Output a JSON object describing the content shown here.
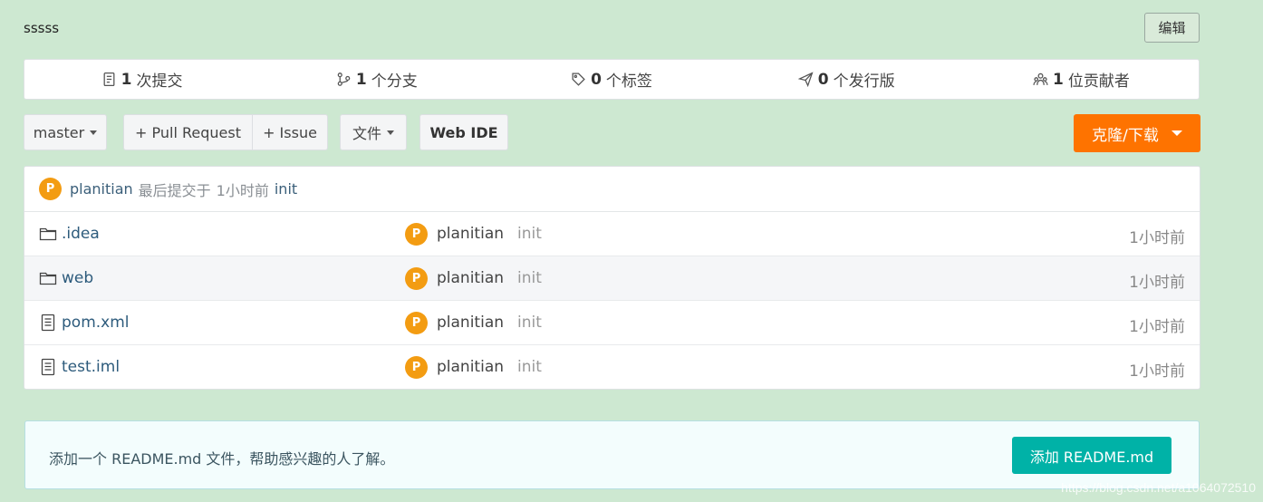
{
  "repo": {
    "description": "sssss",
    "edit_label": "编辑"
  },
  "stats": [
    {
      "icon": "commit-icon",
      "count": "1",
      "label": "次提交"
    },
    {
      "icon": "branch-icon",
      "count": "1",
      "label": "个分支"
    },
    {
      "icon": "tag-icon",
      "count": "0",
      "label": "个标签"
    },
    {
      "icon": "release-icon",
      "count": "0",
      "label": "个发行版"
    },
    {
      "icon": "contributors-icon",
      "count": "1",
      "label": "位贡献者"
    }
  ],
  "toolbar": {
    "branch": "master",
    "pull_request": "+ Pull Request",
    "issue": "+ Issue",
    "file": "文件",
    "web_ide": "Web IDE",
    "clone": "克隆/下载"
  },
  "last_commit": {
    "avatar": "P",
    "author": "planitian",
    "label": "最后提交于",
    "time": "1小时前",
    "message": "init"
  },
  "files": [
    {
      "type": "folder",
      "name": ".idea",
      "avatar": "P",
      "author": "planitian",
      "message": "init",
      "time": "1小时前"
    },
    {
      "type": "folder",
      "name": "web",
      "avatar": "P",
      "author": "planitian",
      "message": "init",
      "time": "1小时前"
    },
    {
      "type": "file",
      "name": "pom.xml",
      "avatar": "P",
      "author": "planitian",
      "message": "init",
      "time": "1小时前"
    },
    {
      "type": "file",
      "name": "test.iml",
      "avatar": "P",
      "author": "planitian",
      "message": "init",
      "time": "1小时前"
    }
  ],
  "readme": {
    "tip": "添加一个 README.md 文件，帮助感兴趣的人了解。",
    "button": "添加 README.md"
  },
  "watermark": "https://blog.csdn.net/a1064072510",
  "colors": {
    "background": "#cde8d1",
    "clone_button": "#fe7300",
    "readme_button": "#00b2a7",
    "avatar": "#f39c12"
  }
}
